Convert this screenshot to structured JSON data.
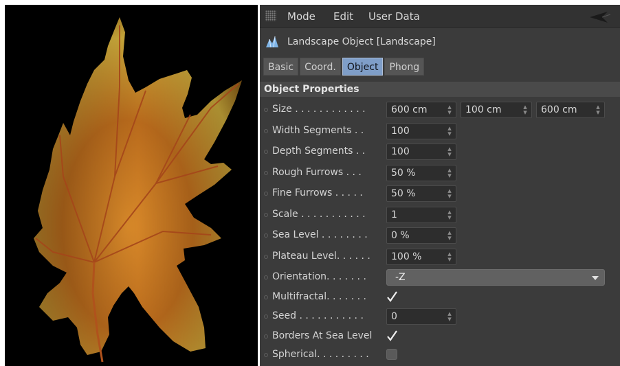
{
  "menubar": {
    "items": [
      "Mode",
      "Edit",
      "User Data"
    ]
  },
  "object": {
    "title": "Landscape Object [Landscape]"
  },
  "tabs": [
    {
      "label": "Basic",
      "active": false
    },
    {
      "label": "Coord.",
      "active": false
    },
    {
      "label": "Object",
      "active": true
    },
    {
      "label": "Phong",
      "active": false
    }
  ],
  "section": {
    "title": "Object Properties"
  },
  "properties": {
    "size": {
      "label": "Size . . . . . . . . . . . .",
      "x": "600 cm",
      "y": "100 cm",
      "z": "600 cm"
    },
    "width_segments": {
      "label": "Width Segments . .",
      "value": "100"
    },
    "depth_segments": {
      "label": "Depth Segments . .",
      "value": "100"
    },
    "rough_furrows": {
      "label": "Rough Furrows . . .",
      "value": "50 %"
    },
    "fine_furrows": {
      "label": "Fine Furrows . . . . .",
      "value": "50 %"
    },
    "scale": {
      "label": "Scale . . . . . . . . . . .",
      "value": "1"
    },
    "sea_level": {
      "label": "Sea Level . . . . . . . .",
      "value": "0 %"
    },
    "plateau_level": {
      "label": "Plateau Level. . . . . .",
      "value": "100 %"
    },
    "orientation": {
      "label": "Orientation. . . . . . .",
      "value": "-Z"
    },
    "multifractal": {
      "label": "Multifractal. . . . . . .",
      "checked": true
    },
    "seed": {
      "label": "Seed . . . . . . . . . . .",
      "value": "0"
    },
    "borders_at_sea_level": {
      "label": "Borders At Sea Level",
      "checked": true
    },
    "spherical": {
      "label": "Spherical. . . . . . . . .",
      "checked": false
    }
  },
  "colors": {
    "panel_bg": "#3b3b3b",
    "active_tab": "#7f9ec8",
    "leaf_orange": "#c9741e",
    "leaf_yellow": "#c7b23a"
  }
}
